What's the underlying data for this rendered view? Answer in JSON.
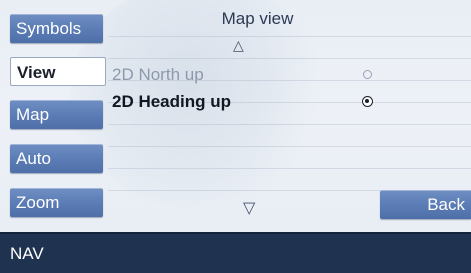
{
  "title": "Map view",
  "side_buttons": [
    {
      "label": "Symbols",
      "active": false
    },
    {
      "label": "View",
      "active": true
    },
    {
      "label": "Map",
      "active": false
    },
    {
      "label": "Auto",
      "active": false
    },
    {
      "label": "Zoom",
      "active": false
    }
  ],
  "options": [
    {
      "label": "2D North up",
      "selected": false
    },
    {
      "label": "2D Heading up",
      "selected": true
    }
  ],
  "scroll_up_symbol": "△",
  "scroll_down_symbol": "▽",
  "back_label": "Back",
  "status_bar": {
    "label": "NAV"
  },
  "colors": {
    "button_blue": "#5a7bb4",
    "status_bar": "#1f3350",
    "background": "#e9eef5"
  }
}
